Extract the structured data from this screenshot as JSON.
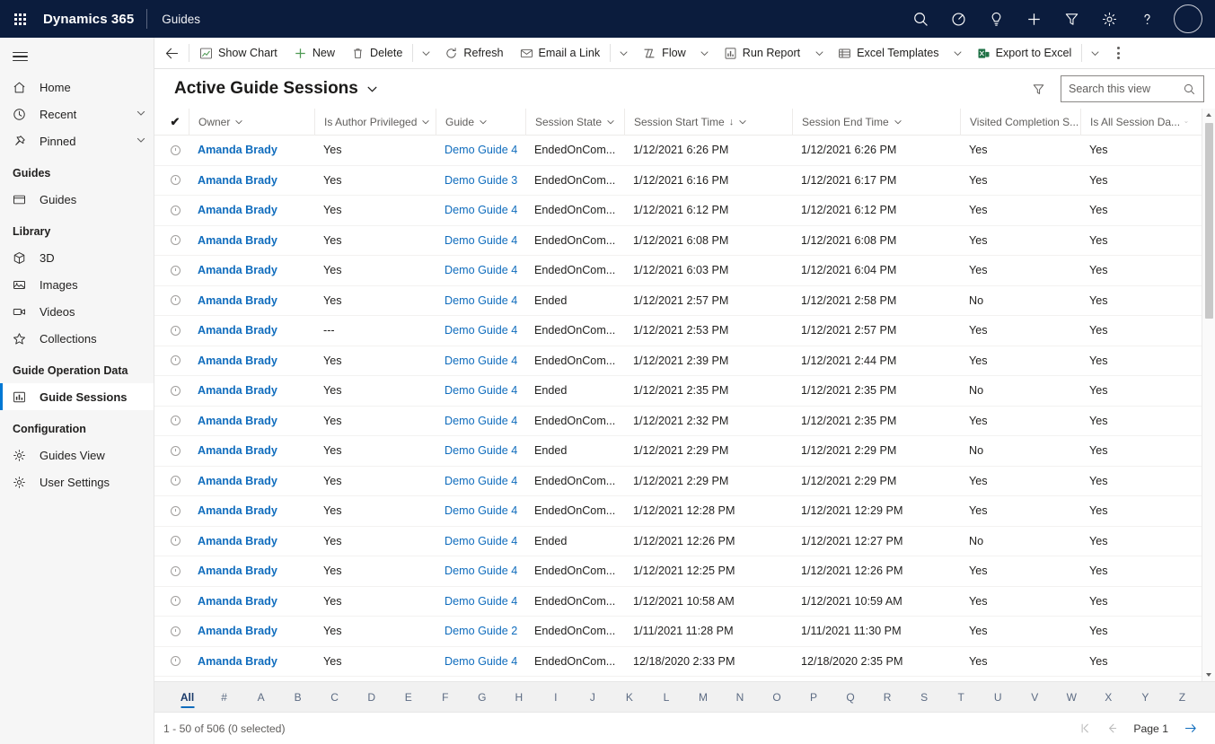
{
  "topnav": {
    "waffle_label": "App launcher",
    "brand": "Dynamics 365",
    "app_name": "Guides",
    "icons": [
      {
        "name": "search-icon",
        "label": "Search"
      },
      {
        "name": "diagnostics-icon",
        "label": "Diagnostics"
      },
      {
        "name": "lightbulb-icon",
        "label": "Insights"
      },
      {
        "name": "plus-icon",
        "label": "Quick create"
      },
      {
        "name": "filter-icon",
        "label": "Filter"
      },
      {
        "name": "gear-icon",
        "label": "Settings"
      },
      {
        "name": "help-icon",
        "label": "Help"
      }
    ],
    "avatar_label": "Account manager"
  },
  "sidebar": {
    "hamburger_label": "Expand navigation",
    "top_items": [
      {
        "label": "Home",
        "icon": "home-icon",
        "chevron": false
      },
      {
        "label": "Recent",
        "icon": "clock-icon",
        "chevron": true
      },
      {
        "label": "Pinned",
        "icon": "pin-icon",
        "chevron": true
      }
    ],
    "groups": [
      {
        "title": "Guides",
        "items": [
          {
            "label": "Guides",
            "icon": "guides-icon",
            "selected": false
          }
        ]
      },
      {
        "title": "Library",
        "items": [
          {
            "label": "3D",
            "icon": "cube-icon",
            "selected": false
          },
          {
            "label": "Images",
            "icon": "image-icon",
            "selected": false
          },
          {
            "label": "Videos",
            "icon": "video-icon",
            "selected": false
          },
          {
            "label": "Collections",
            "icon": "star-icon",
            "selected": false
          }
        ]
      },
      {
        "title": "Guide Operation Data",
        "items": [
          {
            "label": "Guide Sessions",
            "icon": "chart-icon",
            "selected": true
          }
        ]
      },
      {
        "title": "Configuration",
        "items": [
          {
            "label": "Guides View",
            "icon": "gear-icon",
            "selected": false
          },
          {
            "label": "User Settings",
            "icon": "gear-icon",
            "selected": false
          }
        ]
      }
    ]
  },
  "commandbar": {
    "back_label": "Back",
    "buttons": [
      {
        "label": "Show Chart",
        "icon": "show-chart-icon",
        "chevron": false,
        "divider_after": false
      },
      {
        "label": "New",
        "icon": "plus-icon",
        "chevron": false,
        "divider_after": false
      },
      {
        "label": "Delete",
        "icon": "trash-icon",
        "chevron": true,
        "divider_after": true
      },
      {
        "label": "Refresh",
        "icon": "refresh-icon",
        "chevron": false,
        "divider_after": false
      },
      {
        "label": "Email a Link",
        "icon": "email-link-icon",
        "chevron": true,
        "divider_after": true
      },
      {
        "label": "Flow",
        "icon": "flow-icon",
        "chevron": true,
        "divider_after": false
      },
      {
        "label": "Run Report",
        "icon": "run-report-icon",
        "chevron": true,
        "divider_after": false
      },
      {
        "label": "Excel Templates",
        "icon": "excel-templates-icon",
        "chevron": true,
        "divider_after": false
      },
      {
        "label": "Export to Excel",
        "icon": "export-excel-icon",
        "chevron": true,
        "divider_after": true
      }
    ],
    "overflow_label": "More commands"
  },
  "view": {
    "title": "Active Guide Sessions",
    "filter_label": "Show only my records",
    "search_placeholder": "Search this view",
    "search_value": ""
  },
  "grid": {
    "select_all_label": "Select all rows",
    "columns": [
      {
        "key": "owner",
        "label": "Owner",
        "sorted": false
      },
      {
        "key": "auth",
        "label": "Is Author Privileged",
        "sorted": false
      },
      {
        "key": "guide",
        "label": "Guide",
        "sorted": false
      },
      {
        "key": "state",
        "label": "Session State",
        "sorted": false
      },
      {
        "key": "start",
        "label": "Session Start Time",
        "sorted": true,
        "sort_dir": "↓"
      },
      {
        "key": "end",
        "label": "Session End Time",
        "sorted": false
      },
      {
        "key": "visited",
        "label": "Visited Completion S...",
        "sorted": false
      },
      {
        "key": "allses",
        "label": "Is All Session Da...",
        "sorted": false
      }
    ],
    "rows": [
      {
        "owner": "Amanda Brady",
        "auth": "Yes",
        "guide": "Demo Guide 4",
        "state": "EndedOnCom...",
        "start": "1/12/2021 6:26 PM",
        "end": "1/12/2021 6:26 PM",
        "visited": "Yes",
        "allses": "Yes"
      },
      {
        "owner": "Amanda Brady",
        "auth": "Yes",
        "guide": "Demo Guide 3",
        "state": "EndedOnCom...",
        "start": "1/12/2021 6:16 PM",
        "end": "1/12/2021 6:17 PM",
        "visited": "Yes",
        "allses": "Yes"
      },
      {
        "owner": "Amanda Brady",
        "auth": "Yes",
        "guide": "Demo Guide 4",
        "state": "EndedOnCom...",
        "start": "1/12/2021 6:12 PM",
        "end": "1/12/2021 6:12 PM",
        "visited": "Yes",
        "allses": "Yes"
      },
      {
        "owner": "Amanda Brady",
        "auth": "Yes",
        "guide": "Demo Guide 4",
        "state": "EndedOnCom...",
        "start": "1/12/2021 6:08 PM",
        "end": "1/12/2021 6:08 PM",
        "visited": "Yes",
        "allses": "Yes"
      },
      {
        "owner": "Amanda Brady",
        "auth": "Yes",
        "guide": "Demo Guide 4",
        "state": "EndedOnCom...",
        "start": "1/12/2021 6:03 PM",
        "end": "1/12/2021 6:04 PM",
        "visited": "Yes",
        "allses": "Yes"
      },
      {
        "owner": "Amanda Brady",
        "auth": "Yes",
        "guide": "Demo Guide 4",
        "state": "Ended",
        "start": "1/12/2021 2:57 PM",
        "end": "1/12/2021 2:58 PM",
        "visited": "No",
        "allses": "Yes"
      },
      {
        "owner": "Amanda Brady",
        "auth": "---",
        "guide": "Demo Guide 4",
        "state": "EndedOnCom...",
        "start": "1/12/2021 2:53 PM",
        "end": "1/12/2021 2:57 PM",
        "visited": "Yes",
        "allses": "Yes"
      },
      {
        "owner": "Amanda Brady",
        "auth": "Yes",
        "guide": "Demo Guide 4",
        "state": "EndedOnCom...",
        "start": "1/12/2021 2:39 PM",
        "end": "1/12/2021 2:44 PM",
        "visited": "Yes",
        "allses": "Yes"
      },
      {
        "owner": "Amanda Brady",
        "auth": "Yes",
        "guide": "Demo Guide 4",
        "state": "Ended",
        "start": "1/12/2021 2:35 PM",
        "end": "1/12/2021 2:35 PM",
        "visited": "No",
        "allses": "Yes"
      },
      {
        "owner": "Amanda Brady",
        "auth": "Yes",
        "guide": "Demo Guide 4",
        "state": "EndedOnCom...",
        "start": "1/12/2021 2:32 PM",
        "end": "1/12/2021 2:35 PM",
        "visited": "Yes",
        "allses": "Yes"
      },
      {
        "owner": "Amanda Brady",
        "auth": "Yes",
        "guide": "Demo Guide 4",
        "state": "Ended",
        "start": "1/12/2021 2:29 PM",
        "end": "1/12/2021 2:29 PM",
        "visited": "No",
        "allses": "Yes"
      },
      {
        "owner": "Amanda Brady",
        "auth": "Yes",
        "guide": "Demo Guide 4",
        "state": "EndedOnCom...",
        "start": "1/12/2021 2:29 PM",
        "end": "1/12/2021 2:29 PM",
        "visited": "Yes",
        "allses": "Yes"
      },
      {
        "owner": "Amanda Brady",
        "auth": "Yes",
        "guide": "Demo Guide 4",
        "state": "EndedOnCom...",
        "start": "1/12/2021 12:28 PM",
        "end": "1/12/2021 12:29 PM",
        "visited": "Yes",
        "allses": "Yes"
      },
      {
        "owner": "Amanda Brady",
        "auth": "Yes",
        "guide": "Demo Guide 4",
        "state": "Ended",
        "start": "1/12/2021 12:26 PM",
        "end": "1/12/2021 12:27 PM",
        "visited": "No",
        "allses": "Yes"
      },
      {
        "owner": "Amanda Brady",
        "auth": "Yes",
        "guide": "Demo Guide 4",
        "state": "EndedOnCom...",
        "start": "1/12/2021 12:25 PM",
        "end": "1/12/2021 12:26 PM",
        "visited": "Yes",
        "allses": "Yes"
      },
      {
        "owner": "Amanda Brady",
        "auth": "Yes",
        "guide": "Demo Guide 4",
        "state": "EndedOnCom...",
        "start": "1/12/2021 10:58 AM",
        "end": "1/12/2021 10:59 AM",
        "visited": "Yes",
        "allses": "Yes"
      },
      {
        "owner": "Amanda Brady",
        "auth": "Yes",
        "guide": "Demo Guide 2",
        "state": "EndedOnCom...",
        "start": "1/11/2021 11:28 PM",
        "end": "1/11/2021 11:30 PM",
        "visited": "Yes",
        "allses": "Yes"
      },
      {
        "owner": "Amanda Brady",
        "auth": "Yes",
        "guide": "Demo Guide 4",
        "state": "EndedOnCom...",
        "start": "12/18/2020 2:33 PM",
        "end": "12/18/2020 2:35 PM",
        "visited": "Yes",
        "allses": "Yes"
      }
    ]
  },
  "alphabar": {
    "active": "All",
    "letters": [
      "All",
      "#",
      "A",
      "B",
      "C",
      "D",
      "E",
      "F",
      "G",
      "H",
      "I",
      "J",
      "K",
      "L",
      "M",
      "N",
      "O",
      "P",
      "Q",
      "R",
      "S",
      "T",
      "U",
      "V",
      "W",
      "X",
      "Y",
      "Z"
    ]
  },
  "statusbar": {
    "record_count": "1 - 50 of 506 (0 selected)",
    "page_label": "Page 1",
    "first_page_label": "First page",
    "prev_page_label": "Previous page",
    "next_page_label": "Next page"
  },
  "colors": {
    "nav_bg": "#0b1c3d",
    "accent": "#0078d4",
    "link": "#0f6cbd",
    "sidebar_bg": "#f6f6f6"
  }
}
